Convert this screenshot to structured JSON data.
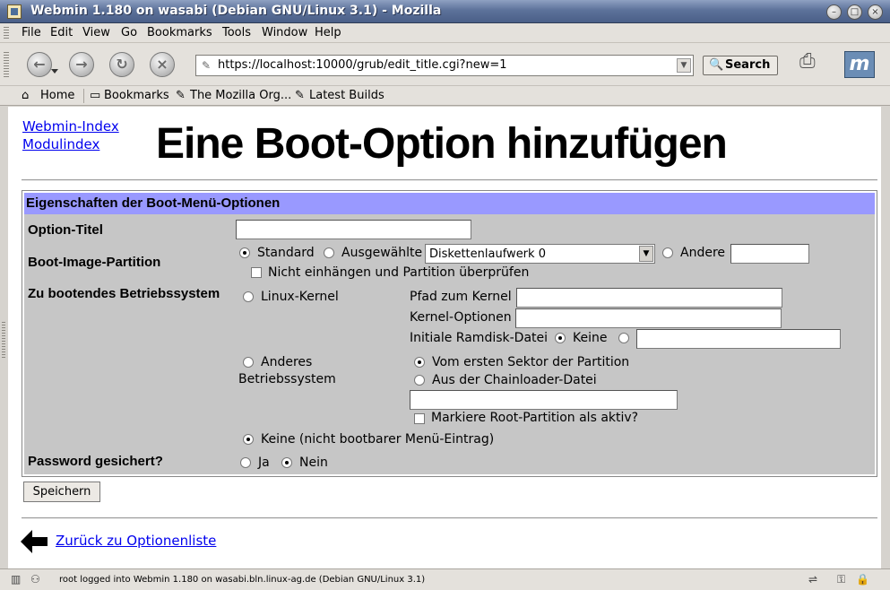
{
  "window": {
    "title": "Webmin 1.180 on wasabi (Debian GNU/Linux 3.1) - Mozilla"
  },
  "menu": [
    "File",
    "Edit",
    "View",
    "Go",
    "Bookmarks",
    "Tools",
    "Window",
    "Help"
  ],
  "nav": {
    "url": "https://localhost:10000/grub/edit_title.cgi?new=1",
    "search_label": "Search"
  },
  "personal_bar": {
    "home": "Home",
    "bookmarks": "Bookmarks",
    "mozilla_org": "The Mozilla Org...",
    "latest_builds": "Latest Builds"
  },
  "page": {
    "link_webmin_index": "Webmin-Index",
    "link_module_index": "Modulindex",
    "title": "Eine Boot-Option hinzufügen"
  },
  "form": {
    "header": "Eigenschaften der Boot-Menü-Optionen",
    "option_title_label": "Option-Titel",
    "option_title_value": "",
    "boot_image_label": "Boot-Image-Partition",
    "radio_standard": "Standard",
    "radio_selected": "Ausgewählte",
    "partition_select_value": "Diskettenlaufwerk 0",
    "radio_other": "Andere",
    "other_partition_value": "",
    "no_mount_check": "Nicht einhängen und Partition überprüfen",
    "os_label": "Zu bootendes Betriebssystem",
    "linux_kernel": "Linux-Kernel",
    "kernel_path_label": "Pfad zum Kernel",
    "kernel_path_value": "",
    "kernel_options_label": "Kernel-Optionen",
    "kernel_options_value": "",
    "ramdisk_label": "Initiale Ramdisk-Datei",
    "ramdisk_none": "Keine",
    "ramdisk_value": "",
    "other_os_line1": "Anderes",
    "other_os_line2": "Betriebssystem",
    "first_sector": "Vom ersten Sektor der Partition",
    "chainloader": "Aus der Chainloader-Datei",
    "chainloader_value": "",
    "mark_root_active": "Markiere Root-Partition als aktiv?",
    "none_entry": "Keine (nicht bootbarer Menü-Eintrag)",
    "password_label": "Password gesichert?",
    "yes": "Ja",
    "no": "Nein",
    "save_button": "Speichern"
  },
  "footer": {
    "back_link": "Zurück zu Optionenliste"
  },
  "status": {
    "text": "root logged into Webmin 1.180 on wasabi.bln.linux-ag.de (Debian GNU/Linux 3.1)"
  }
}
